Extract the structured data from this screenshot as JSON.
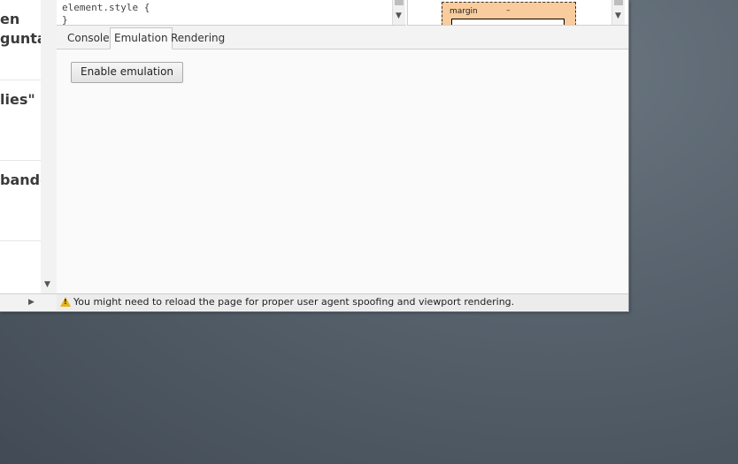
{
  "page": {
    "text_lines": [
      "en",
      "gunta",
      "lies\"",
      "bandc"
    ]
  },
  "styles": {
    "line1": "element.style {",
    "line2": "}"
  },
  "metrics": {
    "margin_label": "margin",
    "margin_value": "–"
  },
  "tabs": [
    {
      "label": "Console"
    },
    {
      "label": "Emulation",
      "active": true
    },
    {
      "label": "Rendering"
    }
  ],
  "emulation": {
    "button_label": "Enable emulation"
  },
  "status": {
    "message": "You might need to reload the page for proper user agent spoofing and viewport rendering."
  },
  "colors": {
    "margin_box": "#f9cc9d",
    "warning": "#e7b416"
  }
}
